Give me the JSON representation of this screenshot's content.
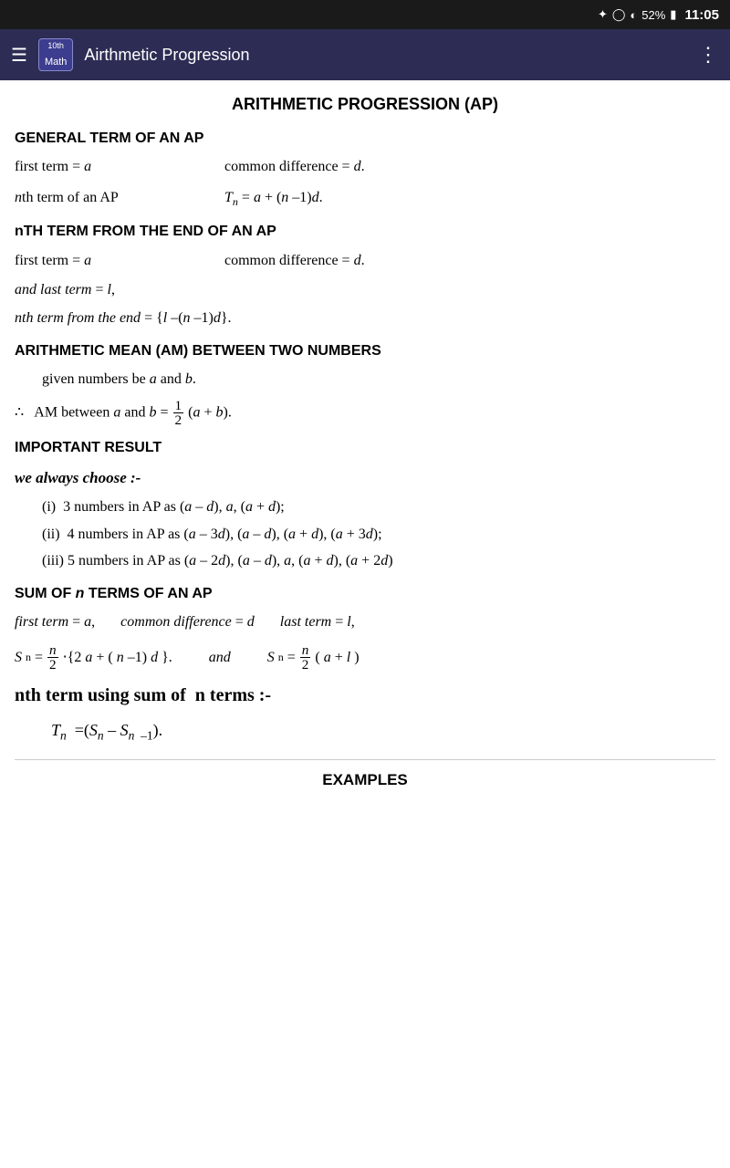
{
  "statusBar": {
    "time": "11:05",
    "battery": "52%"
  },
  "navBar": {
    "badge_super": "10th",
    "badge_sub": "Math",
    "title": "Airthmetic Progression"
  },
  "content": {
    "mainTitle": "ARITHMETIC PROGRESSION (AP)",
    "section1": {
      "heading": "GENERAL TERM OF AN AP",
      "row1_left": "first term = a",
      "row1_right": "common difference = d.",
      "row2_left": "nth term of an AP",
      "row2_right": "Tₙ = a + (n – 1)d."
    },
    "section2": {
      "heading": "nTH TERM FROM THE END OF AN AP",
      "row1_left": "first term = a",
      "row1_right": "common difference = d.",
      "row2": "and last term = l,",
      "row3": "nth term from the end = {l – (n – 1)d}."
    },
    "section3": {
      "heading": "ARITHMETIC MEAN (AM) BETWEEN TWO NUMBERS",
      "row1": "given numbers be a and b.",
      "row2": "∴  AM between a and b = ½(a + b)."
    },
    "section4": {
      "heading": "IMPORTANT RESULT",
      "subheading": "we always choose :-",
      "item1": "(i)  3 numbers in AP as (a – d), a, (a + d);",
      "item2": "(ii)  4 numbers in AP as (a – 3d), (a – d), (a + d), (a + 3d);",
      "item3": "(iii) 5 numbers in AP as (a – 2d), (a – d), a, (a + d), (a + 2d)"
    },
    "section5": {
      "heading": "SUM OF n TERMS OF AN AP",
      "row1_left": "first term = a,",
      "row1_mid": "common difference = d",
      "row1_right": "last term = l,",
      "row2_left": "Sₙ = n/2 · {2a + (n – 1)d}.",
      "row2_mid": "and",
      "row2_right": "Sₙ = n/2(a + l)"
    },
    "section6": {
      "heading": "nth term using sum of  n terms :-",
      "formula": "Tₙ = (Sₙ – Sₙ ₋₁)."
    },
    "examples": "EXAMPLES"
  }
}
